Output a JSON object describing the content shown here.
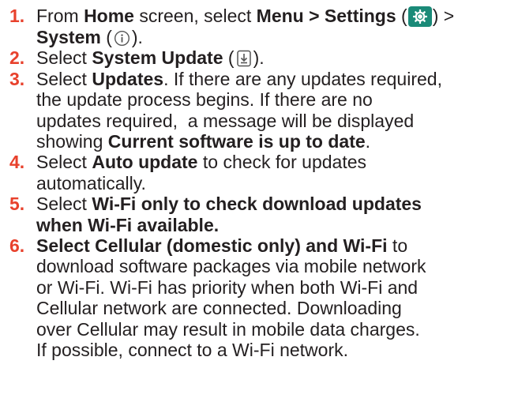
{
  "icons": {
    "settings": "gear-icon",
    "system": "info-icon",
    "system_update": "download-icon"
  },
  "colors": {
    "step_number": "#e8412c",
    "text": "#231f20",
    "settings_icon_bg": "#1a8a78"
  },
  "steps": [
    {
      "number": "1.",
      "t1": "From ",
      "b1": "Home",
      "t2": " screen, select ",
      "b2": "Menu > Settings",
      "t3": " (",
      "t4": ") >",
      "b3": "System",
      "t5": " (",
      "t6": ")."
    },
    {
      "number": "2.",
      "t1": "Select ",
      "b1": "System Update",
      "t2": " (",
      "t3": ")."
    },
    {
      "number": "3.",
      "t1": "Select ",
      "b1": "Updates",
      "t2": ". If there are any updates required,",
      "l2": "the update process begins. If there are no",
      "l3": "updates required,  a message will be displayed",
      "l4a": "showing ",
      "b2": "Current software is up to date",
      "l4b": "."
    },
    {
      "number": "4.",
      "t1": "Select ",
      "b1": "Auto update",
      "t2": " to check for updates",
      "l2": "automatically."
    },
    {
      "number": "5.",
      "t1": "Select ",
      "b1": "Wi-Fi only to check download updates",
      "b2": "when Wi-Fi available."
    },
    {
      "number": "6.",
      "b1": "Select Cellular (domestic only) and Wi-Fi",
      "t1": " to",
      "l2": "download software packages via mobile network",
      "l3": "or Wi-Fi. Wi-Fi has priority when both Wi-Fi and",
      "l4": "Cellular network are connected. Downloading",
      "l5": "over Cellular may result in mobile data charges.",
      "l6": "If possible, connect to a Wi-Fi network."
    }
  ]
}
